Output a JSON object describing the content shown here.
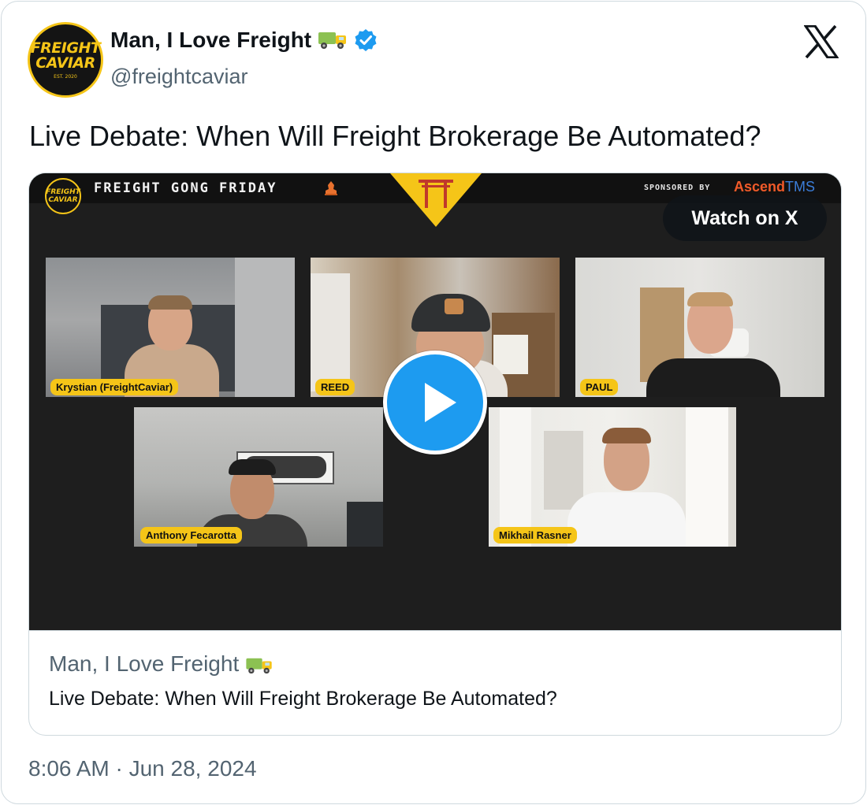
{
  "author": {
    "name": "Man, I Love Freight",
    "handle": "@freightcaviar",
    "verified": true,
    "avatar_text": [
      "FREIGHT",
      "CAVIAR",
      "EST. 2020"
    ],
    "emoji": "truck-icon"
  },
  "tweet": {
    "text": "Live Debate: When Will Freight Brokerage Be Automated?",
    "timestamp": "8:06 AM · Jun 28, 2024"
  },
  "video": {
    "show_title": "FREIGHT GONG FRIDAY",
    "sponsored_label": "SPONSORED BY",
    "sponsor_brand": "Ascend",
    "sponsor_brand_suffix": "TMS",
    "watch_label": "Watch on X",
    "mini_logo_text": [
      "FREIGHT",
      "CAVIAR"
    ],
    "participants": [
      "Krystian (FreightCaviar)",
      "REED",
      "PAUL",
      "Anthony Fecarotta",
      "Mikhail Rasner"
    ]
  },
  "embed_card": {
    "site_name": "Man, I Love Freight",
    "title": "Live Debate: When Will Freight Brokerage Be Automated?"
  },
  "colors": {
    "brand_yellow": "#f5c518",
    "x_blue": "#1d9bf0",
    "text_secondary": "#536471",
    "border": "#cfd9de"
  }
}
